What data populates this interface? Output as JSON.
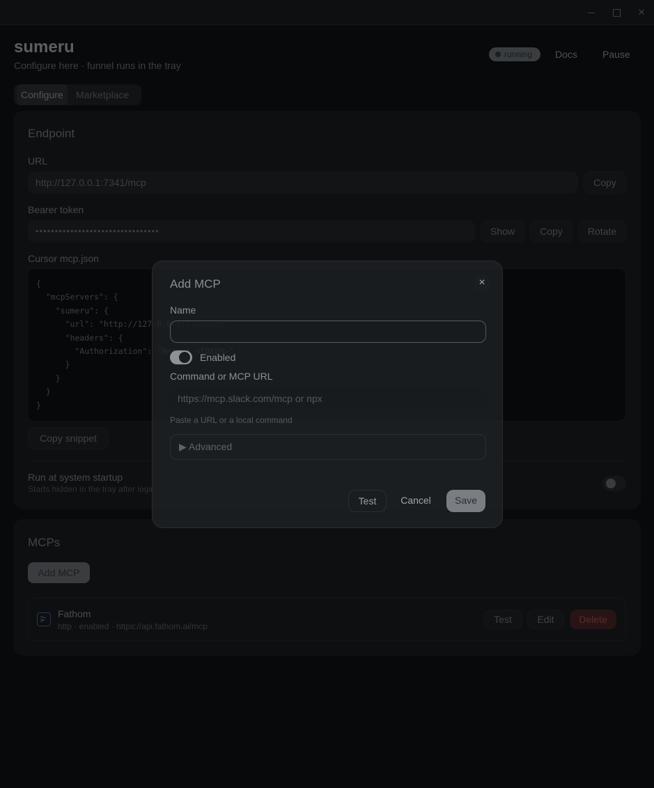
{
  "app": {
    "title": "sumeru",
    "subtitle": "Configure here · funnel runs in the tray",
    "status": "running",
    "docs_label": "Docs",
    "pause_label": "Pause"
  },
  "tabs": [
    {
      "label": "Configure",
      "active": true
    },
    {
      "label": "Marketplace",
      "active": false
    }
  ],
  "endpoint": {
    "title": "Endpoint",
    "url_label": "URL",
    "url_value": "http://127.0.0.1:7341/mcp",
    "copy_label": "Copy",
    "token_label": "Bearer token",
    "token_value": "••••••••••••••••••••••••••••••••",
    "show_label": "Show",
    "rotate_label": "Rotate",
    "cursor_label": "Cursor mcp.json",
    "code": "{\n  \"mcpServers\": {\n    \"sumeru\": {\n      \"url\": \"http://127.0.0.1:7341/mcp\",\n      \"headers\": {\n        \"Authorization\": \"Bearer <TOKEN>\"\n      }\n    }\n  }\n}",
    "copy_snippet_label": "Copy snippet",
    "startup_title": "Run at system startup",
    "startup_sub": "Starts hidden in the tray after login",
    "startup_enabled": false
  },
  "mcps": {
    "title": "MCPs",
    "add_label": "Add MCP",
    "items": [
      {
        "name": "Fathom",
        "meta": "http · enabled · https://api.fathom.ai/mcp",
        "test_label": "Test",
        "edit_label": "Edit",
        "delete_label": "Delete"
      }
    ]
  },
  "modal": {
    "title": "Add MCP",
    "name_label": "Name",
    "name_value": "",
    "enabled_label": "Enabled",
    "enabled": true,
    "command_label": "Command or MCP URL",
    "command_placeholder": "https://mcp.slack.com/mcp or npx",
    "hint": "Paste a URL or a local command",
    "advanced_label": "▶ Advanced",
    "test_label": "Test",
    "cancel_label": "Cancel",
    "save_label": "Save",
    "close_icon": "×"
  },
  "colors": {
    "background": "#0c0e10",
    "card": "#15181b",
    "delete": "#8a4448",
    "mcp_icon": "#3c556d"
  }
}
